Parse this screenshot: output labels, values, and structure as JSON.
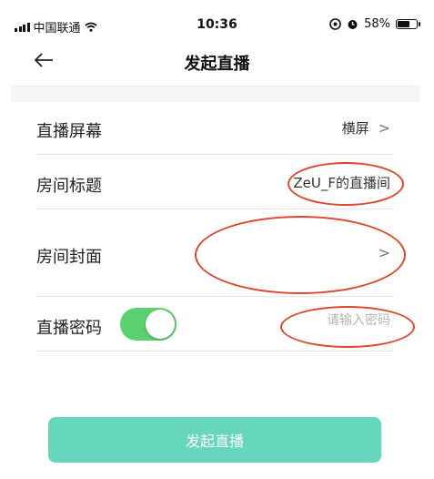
{
  "status_bar": {
    "carrier": "中国联通",
    "time": "10:36",
    "battery_text": "58%",
    "battery_level": 0.58
  },
  "nav": {
    "back_icon": "arrow-left-icon",
    "title": "发起直播"
  },
  "settings": {
    "screen_label": "直播屏幕",
    "screen_value": "横屏",
    "title_label": "房间标题",
    "title_value": "ZeU_F的直播间",
    "cover_label": "房间封面",
    "password_label": "直播密码",
    "password_placeholder": "请输入密码",
    "password_enabled": true
  },
  "start_button_label": "发起直播",
  "colors": {
    "accent": "#66d6bc",
    "toggle_on": "#5bd070",
    "annotation": "#e0462b"
  }
}
